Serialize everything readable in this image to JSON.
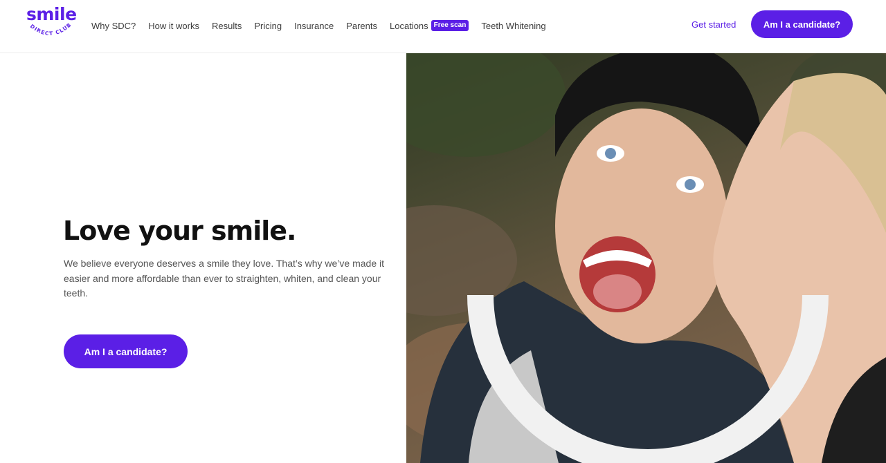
{
  "brand": {
    "logo_word": "smile",
    "logo_sub": "DIRECT CLUB",
    "accent": "#5b1fe6"
  },
  "nav": {
    "items": [
      {
        "label": "Why SDC?"
      },
      {
        "label": "How it works"
      },
      {
        "label": "Results"
      },
      {
        "label": "Pricing"
      },
      {
        "label": "Insurance"
      },
      {
        "label": "Parents"
      },
      {
        "label": "Locations",
        "badge": "Free scan"
      },
      {
        "label": "Teeth Whitening"
      }
    ]
  },
  "header": {
    "get_started": "Get started",
    "cta": "Am I a candidate?"
  },
  "hero": {
    "title": "Love your smile.",
    "text": "We believe everyone deserves a smile they love. That’s why we’ve made it easier and more affordable than ever to straighten, whiten, and clean your teeth.",
    "cta": "Am I a candidate?",
    "photo_icon": "smiling-couple-photo",
    "overlay_icon": "smile-arc-icon"
  }
}
